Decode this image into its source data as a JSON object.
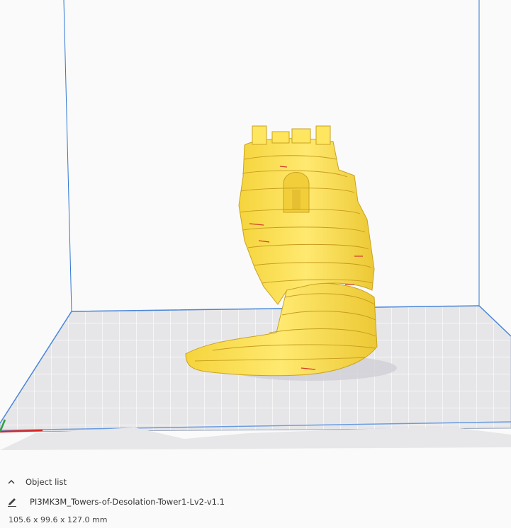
{
  "viewport": {
    "bed_grid_color": "#e5e5ea",
    "bed_line_color": "#7f8aa3",
    "bed_edge_color": "#3a7bd5",
    "model_color": "#ffe45c",
    "model_shadow_color": "#d9b226",
    "build_volume_line_color": "#2f76d2",
    "axis_x_color": "#d62828",
    "axis_y_color": "#2e9e3a"
  },
  "object_list": {
    "toggle_label": "Object list",
    "toggle_icon": "chevron-up-icon",
    "edit_icon": "pencil-icon",
    "object_name": "PI3MK3M_Towers-of-Desolation-Tower1-Lv2-v1.1",
    "dimensions": "105.6 x 99.6 x 127.0 mm"
  }
}
